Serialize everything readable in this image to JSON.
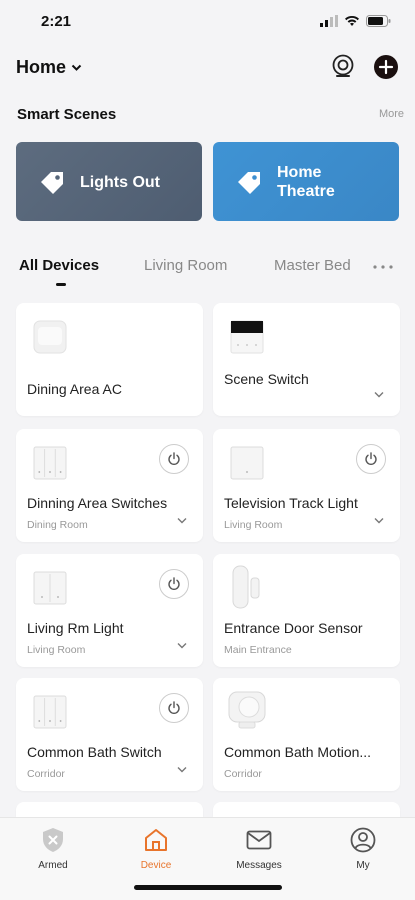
{
  "status": {
    "time": "2:21"
  },
  "header": {
    "home_label": "Home"
  },
  "scenes": {
    "title": "Smart Scenes",
    "more": "More",
    "items": [
      {
        "label_line1": "Lights Out",
        "label_line2": ""
      },
      {
        "label_line1": "Home",
        "label_line2": "Theatre"
      }
    ]
  },
  "tabs": [
    "All Devices",
    "Living Room",
    "Master Bed"
  ],
  "devices": [
    {
      "name": "Dining Area AC",
      "room": ""
    },
    {
      "name": "Scene Switch",
      "room": ""
    },
    {
      "name": "Dinning Area Switches",
      "room": "Dining Room"
    },
    {
      "name": "Television Track Light",
      "room": "Living Room"
    },
    {
      "name": "Living Rm Light",
      "room": "Living Room"
    },
    {
      "name": "Entrance Door Sensor",
      "room": "Main Entrance"
    },
    {
      "name": "Common Bath Switch",
      "room": "Corridor"
    },
    {
      "name": "Common Bath Motion...",
      "room": "Corridor"
    }
  ],
  "tabbar": {
    "items": [
      {
        "label": "Armed",
        "icon": "shield-icon"
      },
      {
        "label": "Device",
        "icon": "home-icon"
      },
      {
        "label": "Messages",
        "icon": "mail-icon"
      },
      {
        "label": "My",
        "icon": "user-icon"
      }
    ]
  },
  "colors": {
    "accent": "#e8742b",
    "scene_1": "#57667a",
    "scene_2": "#3d8fd0"
  }
}
